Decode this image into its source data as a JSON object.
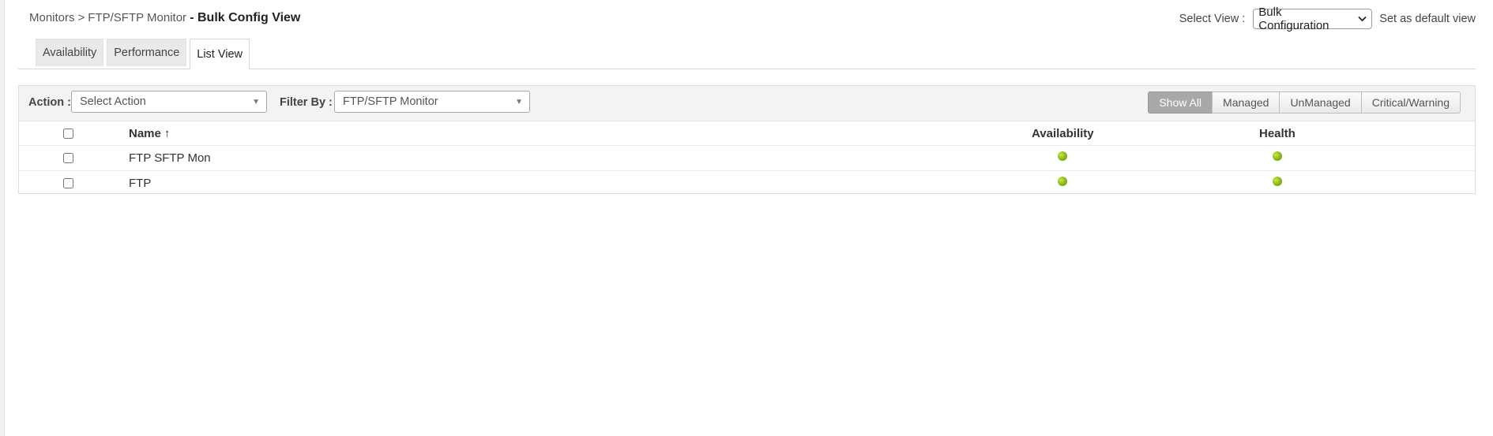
{
  "breadcrumb": {
    "root": "Monitors",
    "separator": ">",
    "parent": "FTP/SFTP Monitor",
    "current": "- Bulk Config View"
  },
  "view_select": {
    "label": "Select View :",
    "value": "Bulk Configuration",
    "default_link": "Set as default view"
  },
  "tabs": [
    {
      "label": "Availability",
      "active": false
    },
    {
      "label": "Performance",
      "active": false
    },
    {
      "label": "List View",
      "active": true
    }
  ],
  "toolbar": {
    "action_label": "Action :",
    "action_placeholder": "Select Action",
    "filter_label": "Filter By :",
    "filter_value": "FTP/SFTP Monitor"
  },
  "filters": [
    {
      "label": "Show All",
      "active": true
    },
    {
      "label": "Managed",
      "active": false
    },
    {
      "label": "UnManaged",
      "active": false
    },
    {
      "label": "Critical/Warning",
      "active": false
    }
  ],
  "table": {
    "columns": {
      "name": "Name",
      "sort_indicator": "↑",
      "availability": "Availability",
      "health": "Health"
    },
    "rows": [
      {
        "name": "FTP SFTP Mon",
        "availability": "up",
        "health": "clear"
      },
      {
        "name": "FTP",
        "availability": "up",
        "health": "clear"
      }
    ]
  },
  "colors": {
    "status_green": "#7fb21a",
    "active_filter": "#a8a8a8"
  },
  "icons": {
    "sort": "arrow-up-icon",
    "view_dropdown": "chevron-down-icon",
    "dropdown": "caret-down-icon",
    "status": "green-dot-icon"
  }
}
